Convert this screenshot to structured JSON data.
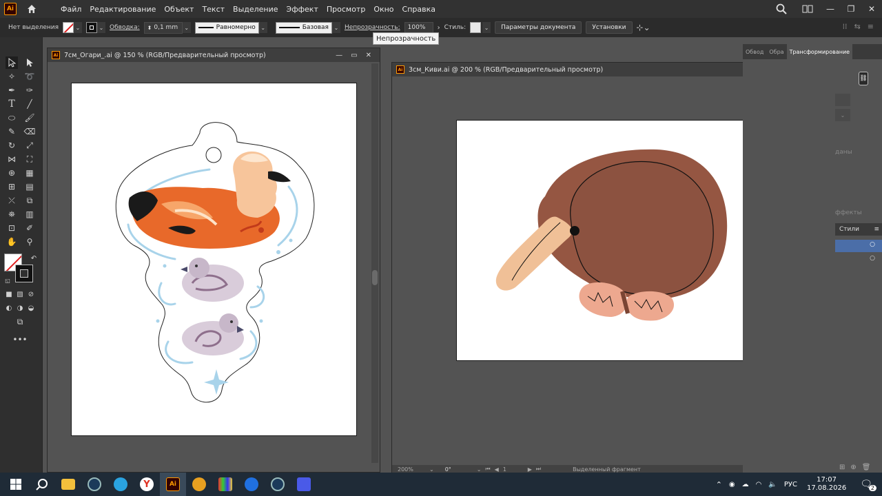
{
  "app": {
    "logo_text": "Ai",
    "menu": [
      "Файл",
      "Редактирование",
      "Объект",
      "Текст",
      "Выделение",
      "Эффект",
      "Просмотр",
      "Окно",
      "Справка"
    ]
  },
  "control_bar": {
    "selection_label": "Нет выделения",
    "stroke_label": "Обводка:",
    "stroke_value": "0,1 mm",
    "profile_label": "Равномерно",
    "brush_label": "Базовая",
    "opacity_label": "Непрозрачность:",
    "opacity_value": "100%",
    "style_label": "Стиль:",
    "doc_settings_button": "Параметры документа",
    "preferences_button": "Установки",
    "tooltip": "Непрозрачность"
  },
  "documents": [
    {
      "title": "7см_Огари_.ai @ 150 % (RGB/Предварительный просмотр)"
    },
    {
      "title": "3см_Киви.ai @ 200 % (RGB/Предварительный просмотр)"
    }
  ],
  "status_bar": {
    "zoom": "200%",
    "rotation": "0°",
    "artboard_nav": "1",
    "mode": "Выделенный фрагмент"
  },
  "right_panel": {
    "tabs": [
      "Обвод",
      "Обра",
      "Трансформирование"
    ],
    "partial_labels": [
      "даны",
      "ффекты"
    ],
    "styles_tab": "Стили"
  },
  "taskbar": {
    "language": "РУС",
    "time": "17:07",
    "date": "17.08.2026",
    "notification_count": "2"
  },
  "colors": {
    "duck_orange": "#e8692a",
    "kiwi_brown": "#955642",
    "kiwi_beak": "#f0c097",
    "kiwi_feet": "#eda88f",
    "water_blue": "#a8d3ea"
  }
}
